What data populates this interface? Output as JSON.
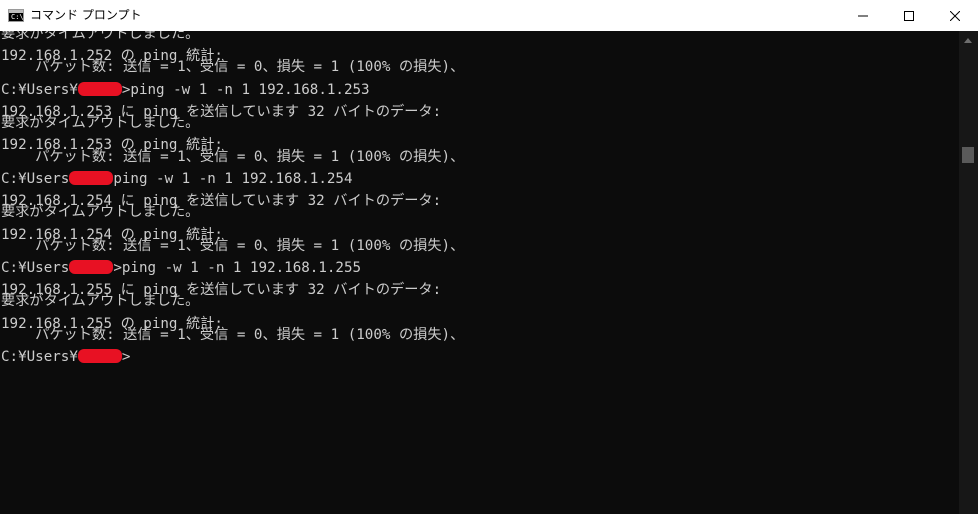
{
  "window": {
    "title": "コマンド プロンプト",
    "app_icon_text": "C:\\",
    "controls": {
      "minimize": "minimize-icon",
      "maximize": "maximize-icon",
      "close": "close-icon"
    }
  },
  "console": {
    "lines": [
      {
        "text": "要求がタイムアウトしました。"
      },
      {
        "text": ""
      },
      {
        "text": "192.168.1.252 の ping 統計:"
      },
      {
        "text": "    パケット数: 送信 = 1、受信 = 0、損失 = 1 (100% の損失)、"
      },
      {
        "text": ""
      },
      {
        "prefix": "C:¥Users¥",
        "redacted": true,
        "suffix": ">ping -w 1 -n 1 192.168.1.253"
      },
      {
        "text": ""
      },
      {
        "text": "192.168.1.253 に ping を送信しています 32 バイトのデータ:"
      },
      {
        "text": "要求がタイムアウトしました。"
      },
      {
        "text": ""
      },
      {
        "text": "192.168.1.253 の ping 統計:"
      },
      {
        "text": "    パケット数: 送信 = 1、受信 = 0、損失 = 1 (100% の損失)、"
      },
      {
        "text": ""
      },
      {
        "prefix": "C:¥Users",
        "redacted": true,
        "suffix": "ping -w 1 -n 1 192.168.1.254"
      },
      {
        "text": ""
      },
      {
        "text": "192.168.1.254 に ping を送信しています 32 バイトのデータ:"
      },
      {
        "text": "要求がタイムアウトしました。"
      },
      {
        "text": ""
      },
      {
        "text": "192.168.1.254 の ping 統計:"
      },
      {
        "text": "    パケット数: 送信 = 1、受信 = 0、損失 = 1 (100% の損失)、"
      },
      {
        "text": ""
      },
      {
        "prefix": "C:¥Users",
        "redacted": true,
        "suffix": ">ping -w 1 -n 1 192.168.1.255"
      },
      {
        "text": ""
      },
      {
        "text": "192.168.1.255 に ping を送信しています 32 バイトのデータ:"
      },
      {
        "text": "要求がタイムアウトしました。"
      },
      {
        "text": ""
      },
      {
        "text": "192.168.1.255 の ping 統計:"
      },
      {
        "text": "    パケット数: 送信 = 1、受信 = 0、損失 = 1 (100% の損失)、"
      },
      {
        "text": ""
      },
      {
        "prefix": "C:¥Users¥",
        "redacted": true,
        "suffix": ">"
      }
    ]
  },
  "colors": {
    "console_background": "#0c0c0c",
    "console_text": "#cccccc",
    "redaction": "#e81123",
    "titlebar_background": "#ffffff"
  }
}
